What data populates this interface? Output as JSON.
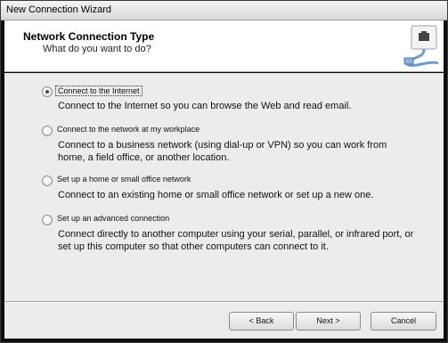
{
  "window": {
    "title": "New Connection Wizard"
  },
  "header": {
    "title": "Network Connection Type",
    "subtitle": "What do you want to do?",
    "icon": "network-plug-icon"
  },
  "options": [
    {
      "label": "Connect to the Internet",
      "description": "Connect to the Internet so you can browse the Web and read email.",
      "selected": true
    },
    {
      "label": "Connect to the network at my workplace",
      "description": "Connect to a business network (using dial-up or VPN) so you can work from home, a field office, or another location.",
      "selected": false
    },
    {
      "label": "Set up a home or small office network",
      "description": "Connect to an existing home or small office network or set up a new one.",
      "selected": false
    },
    {
      "label": "Set up an advanced connection",
      "description": "Connect directly to another computer using your serial, parallel, or infrared port, or set up this computer so that other computers can connect to it.",
      "selected": false
    }
  ],
  "buttons": {
    "back": "< Back",
    "next": "Next >",
    "cancel": "Cancel"
  }
}
